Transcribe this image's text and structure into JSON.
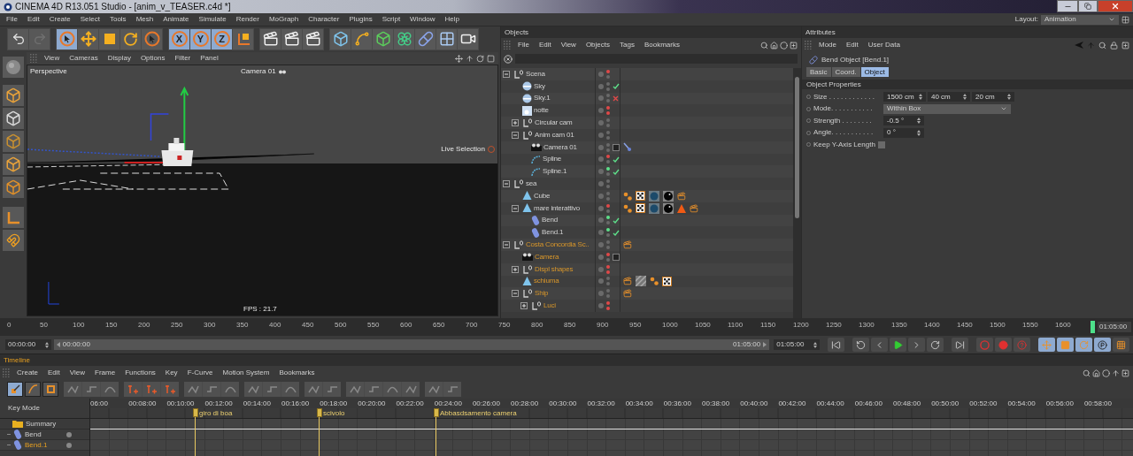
{
  "window": {
    "title": "CINEMA 4D R13.051 Studio - [anim_v_TEASER.c4d *]"
  },
  "menu": [
    "File",
    "Edit",
    "Create",
    "Select",
    "Tools",
    "Mesh",
    "Animate",
    "Simulate",
    "Render",
    "MoGraph",
    "Character",
    "Plugins",
    "Script",
    "Window",
    "Help"
  ],
  "layout": {
    "label": "Layout:",
    "value": "Animation"
  },
  "toolbar": [
    [
      {
        "kind": "undo",
        "selected": false
      },
      {
        "kind": "redo",
        "selected": false
      }
    ],
    [
      {
        "kind": "select",
        "selected": true
      },
      {
        "kind": "move",
        "selected": false
      },
      {
        "kind": "scale",
        "selected": false
      },
      {
        "kind": "rotate",
        "selected": false
      },
      {
        "kind": "select-last",
        "selected": false
      }
    ],
    [
      {
        "kind": "axis",
        "label": "X",
        "selected": true
      },
      {
        "kind": "axis",
        "label": "Y",
        "selected": true
      },
      {
        "kind": "axis",
        "label": "Z",
        "selected": true
      },
      {
        "kind": "coords",
        "selected": false
      }
    ],
    [
      {
        "kind": "render-view",
        "selected": false
      },
      {
        "kind": "render-picture",
        "selected": false
      },
      {
        "kind": "render-settings",
        "selected": false
      }
    ],
    [
      {
        "kind": "cube",
        "selected": false
      },
      {
        "kind": "spline",
        "selected": false
      },
      {
        "kind": "nurbs",
        "selected": false
      },
      {
        "kind": "array",
        "selected": false
      },
      {
        "kind": "deformer",
        "selected": false
      },
      {
        "kind": "floor",
        "selected": false
      },
      {
        "kind": "camera",
        "selected": false
      }
    ]
  ],
  "viewport": {
    "menu": [
      "View",
      "Cameras",
      "Display",
      "Options",
      "Filter",
      "Panel"
    ],
    "name": "Perspective",
    "camera": "Camera 01",
    "tool": "Live Selection",
    "fps": "FPS : 21.7"
  },
  "objects": {
    "title": "Objects",
    "menu": [
      "File",
      "Edit",
      "View",
      "Objects",
      "Tags",
      "Bookmarks"
    ],
    "tree": [
      {
        "name": "Scena",
        "kind": "null",
        "layer": false,
        "expanded": true,
        "editor_dot": {
          "color": "#e04848"
        },
        "render_dot": {
          "color": "#6a6a6a"
        },
        "children": [
          {
            "name": "Sky",
            "kind": "sky",
            "layer": false,
            "editor_dot": {
              "color": "#6a6a6a"
            },
            "render_dot": {
              "color": "#6a6a6a"
            },
            "enabled": true
          },
          {
            "name": "Sky.1",
            "kind": "sky",
            "layer": false,
            "editor_dot": {
              "color": "#6a6a6a"
            },
            "render_dot": {
              "color": "#6a6a6a"
            },
            "enabled": false
          },
          {
            "name": "notte",
            "kind": "light",
            "layer": false,
            "editor_dot": {
              "color": "#e04848"
            },
            "render_dot": {
              "color": "#e04848"
            }
          },
          {
            "name": "Circular cam",
            "kind": "null",
            "layer": false,
            "expanded": false,
            "editor_dot": {
              "color": "#6a6a6a"
            },
            "render_dot": {
              "color": "#6a6a6a"
            }
          },
          {
            "name": "Anim cam 01",
            "kind": "null",
            "layer": false,
            "expanded": true,
            "editor_dot": {
              "color": "#6a6a6a"
            },
            "render_dot": {
              "color": "#6a6a6a"
            },
            "children": [
              {
                "name": "Camera 01",
                "kind": "camera",
                "layer": false,
                "editor_dot": {
                  "color": "#6a6a6a"
                },
                "render_dot": {
                  "color": "#6a6a6a"
                },
                "protected": true,
                "tags": [
                  {
                    "kind": "target"
                  }
                ]
              },
              {
                "name": "Spline",
                "kind": "spline",
                "layer": false,
                "editor_dot": {
                  "color": "#e04848"
                },
                "render_dot": {
                  "color": "#6a6a6a"
                },
                "enabled": true
              },
              {
                "name": "Spline.1",
                "kind": "spline",
                "layer": false,
                "editor_dot": {
                  "color": "#5ee08a"
                },
                "render_dot": {
                  "color": "#6a6a6a"
                },
                "enabled": true
              }
            ]
          }
        ]
      },
      {
        "name": "sea",
        "kind": "null",
        "layer": false,
        "expanded": true,
        "editor_dot": {
          "color": "#6a6a6a"
        },
        "render_dot": {
          "color": "#6a6a6a"
        },
        "children": [
          {
            "name": "Cube",
            "kind": "polygon",
            "layer": false,
            "editor_dot": {
              "color": "#6a6a6a"
            },
            "render_dot": {
              "color": "#6a6a6a"
            },
            "tags": [
              {
                "kind": "texture"
              },
              {
                "kind": "checker"
              },
              {
                "kind": "water"
              },
              {
                "kind": "sphere"
              },
              {
                "kind": "clapper"
              }
            ]
          },
          {
            "name": "mare interattivo",
            "kind": "polygon",
            "layer": false,
            "expanded": true,
            "editor_dot": {
              "color": "#e04848"
            },
            "render_dot": {
              "color": "#6a6a6a"
            },
            "tags": [
              {
                "kind": "texture"
              },
              {
                "kind": "checker"
              },
              {
                "kind": "water"
              },
              {
                "kind": "sphere"
              },
              {
                "kind": "cone"
              },
              {
                "kind": "clapper"
              }
            ],
            "children": [
              {
                "name": "Bend",
                "kind": "bend",
                "layer": false,
                "editor_dot": {
                  "color": "#5ee08a"
                },
                "render_dot": {
                  "color": "#6a6a6a"
                },
                "enabled": true
              },
              {
                "name": "Bend.1",
                "kind": "bend",
                "layer": false,
                "editor_dot": {
                  "color": "#5ee08a"
                },
                "render_dot": {
                  "color": "#6a6a6a"
                },
                "enabled": true
              }
            ]
          }
        ]
      },
      {
        "name": "Costa Concordia Sc..",
        "kind": "null",
        "layer": true,
        "expanded": true,
        "editor_dot": {
          "color": "#6a6a6a"
        },
        "render_dot": {
          "color": "#6a6a6a"
        },
        "tags": [
          {
            "kind": "clapper"
          }
        ],
        "children": [
          {
            "name": "Camera",
            "kind": "camera",
            "layer": true,
            "editor_dot": {
              "color": "#e04848"
            },
            "render_dot": {
              "color": "#6a6a6a"
            },
            "protected": true
          },
          {
            "name": "Displ shapes",
            "kind": "null",
            "layer": true,
            "expanded": false,
            "editor_dot": {
              "color": "#e04848"
            },
            "render_dot": {
              "color": "#e04848"
            }
          },
          {
            "name": "schiuma",
            "kind": "polygon",
            "layer": true,
            "editor_dot": {
              "color": "#6a6a6a"
            },
            "render_dot": {
              "color": "#6a6a6a"
            },
            "tags": [
              {
                "kind": "clapper"
              },
              {
                "kind": "stripes"
              },
              {
                "kind": "texture"
              },
              {
                "kind": "checker"
              }
            ]
          },
          {
            "name": "Ship",
            "kind": "null",
            "layer": true,
            "expanded": true,
            "editor_dot": {
              "color": "#6a6a6a"
            },
            "render_dot": {
              "color": "#6a6a6a"
            },
            "tags": [
              {
                "kind": "clapper"
              }
            ],
            "children": [
              {
                "name": "Luci",
                "kind": "null",
                "layer": true,
                "expanded": false,
                "editor_dot": {
                  "color": "#e04848"
                },
                "render_dot": {
                  "color": "#e04848"
                }
              }
            ]
          }
        ]
      }
    ]
  },
  "attributes": {
    "title": "Attributes",
    "menu": [
      "Mode",
      "Edit",
      "User Data"
    ],
    "object": "Bend Object [Bend.1]",
    "tabs": [
      {
        "label": "Basic",
        "selected": false
      },
      {
        "label": "Coord.",
        "selected": false
      },
      {
        "label": "Object",
        "selected": true
      }
    ],
    "section": "Object Properties",
    "fields": [
      {
        "kind": "vector",
        "label": "Size . . . . . . . . . . . .",
        "values": [
          "1500 cm",
          "40 cm",
          "20 cm"
        ]
      },
      {
        "kind": "dropdown",
        "label": "Mode. . . . . . . . . . .",
        "value": "Within Box"
      },
      {
        "kind": "number",
        "label": "Strength . . . . . . . .",
        "value": "-0.5 °"
      },
      {
        "kind": "number",
        "label": "Angle. . . . . . . . . . .",
        "value": "0 °"
      },
      {
        "kind": "checkbox",
        "label": "Keep Y-Axis Length",
        "checked": false
      }
    ]
  },
  "ruler": {
    "ticks": [
      "0",
      "50",
      "100",
      "150",
      "200",
      "250",
      "300",
      "350",
      "400",
      "450",
      "500",
      "550",
      "600",
      "650",
      "700",
      "750",
      "800",
      "850",
      "900",
      "950",
      "1000",
      "1050",
      "1100",
      "1150",
      "1200",
      "1250",
      "1300",
      "1350",
      "1400",
      "1450",
      "1500",
      "1550",
      "1600"
    ],
    "current": "01:05:00"
  },
  "transport": {
    "start": "00:00:00",
    "range_start": "00:00:00",
    "range_end": "01:05:00",
    "level": 1,
    "end": "01:05:00"
  },
  "timeline": {
    "title": "Timeline",
    "menu": [
      "Create",
      "Edit",
      "View",
      "Frame",
      "Functions",
      "Key",
      "F-Curve",
      "Motion System",
      "Bookmarks"
    ],
    "toolbar": [
      {
        "kind": "key",
        "selected": true
      },
      {
        "kind": "curve",
        "selected": false
      },
      {
        "kind": "sheet",
        "selected": false
      }
    ],
    "mode": "Key Mode",
    "times": [
      "06:00",
      "00:08:00",
      "00:10:00",
      "00:12:00",
      "00:14:00",
      "00:16:00",
      "00:18:00",
      "00:20:00",
      "00:22:00",
      "00:24:00",
      "00:26:00",
      "00:28:00",
      "00:30:00",
      "00:32:00",
      "00:34:00",
      "00:36:00",
      "00:38:00",
      "00:40:00",
      "00:42:00",
      "00:44:00",
      "00:46:00",
      "00:48:00",
      "00:50:00",
      "00:52:00",
      "00:54:00",
      "00:56:00",
      "00:58:00"
    ],
    "markers": [
      {
        "label": "giro di boa"
      },
      {
        "label": "scivolo"
      },
      {
        "label": "Abbasdsamento camera"
      }
    ],
    "tracks": [
      {
        "name": "Summary",
        "kind": "folder",
        "selected": false
      },
      {
        "name": "Bend",
        "kind": "bend",
        "selected": false
      },
      {
        "name": "Bend.1",
        "kind": "bend",
        "selected": true
      }
    ]
  }
}
